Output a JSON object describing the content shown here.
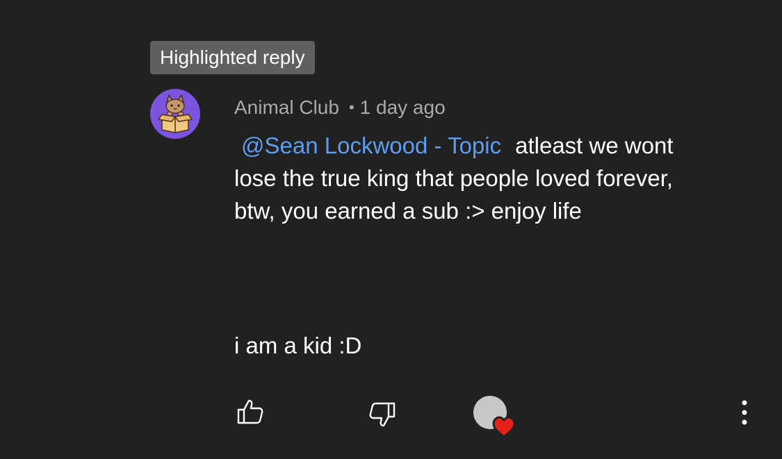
{
  "badge": {
    "label": "Highlighted reply"
  },
  "comment": {
    "author": "Animal Club",
    "separator": "•",
    "time": "1 day ago",
    "mention": "@Sean Lockwood - Topic",
    "line1_rest": "atleast we wont",
    "line2": "lose the true king that people loved forever,",
    "line3": "btw, you earned a sub :> enjoy life",
    "line4": "i am a kid :D"
  },
  "icons": {
    "like": "thumbs-up-icon",
    "dislike": "thumbs-down-icon",
    "creator_heart": "creator-heart-icon",
    "more": "more-vertical-icon"
  },
  "colors": {
    "background": "#212121",
    "mention": "#5e9ef0",
    "badge": "#606060",
    "avatar": "#7b55e0",
    "heart": "#e62117"
  }
}
